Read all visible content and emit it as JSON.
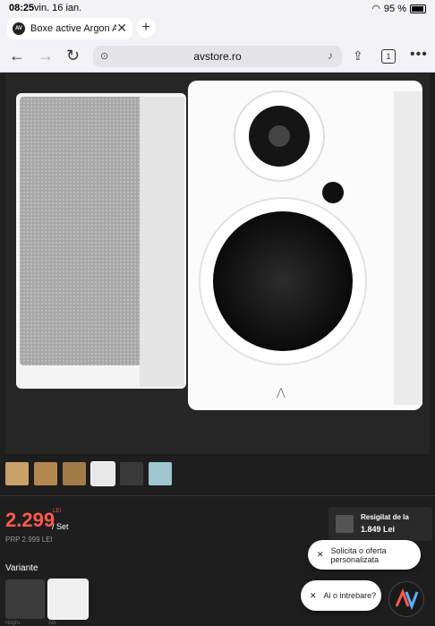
{
  "status_bar": {
    "time": "08:25",
    "date": "vin. 16 ian.",
    "battery": "95 %"
  },
  "browser": {
    "tab_title": "Boxe active Argon Audio",
    "favicon_text": "AV",
    "url": "avstore.ro",
    "tab_count": "1"
  },
  "product": {
    "price": "2.299",
    "currency": "LEI",
    "unit": "/ Set",
    "rrp": "PRP 2.999 LEI",
    "resigilat_label": "Resigilat de la",
    "resigilat_price": "1.849 Lei",
    "variants_label": "Variante",
    "variant_names": [
      "Negru",
      "Alb"
    ]
  },
  "popups": {
    "offer": "Solicita o oferta personalizata",
    "question": "Ai o intrebare?"
  },
  "colors": {
    "price": "#ff5a4a",
    "background": "#1e1e1e"
  }
}
